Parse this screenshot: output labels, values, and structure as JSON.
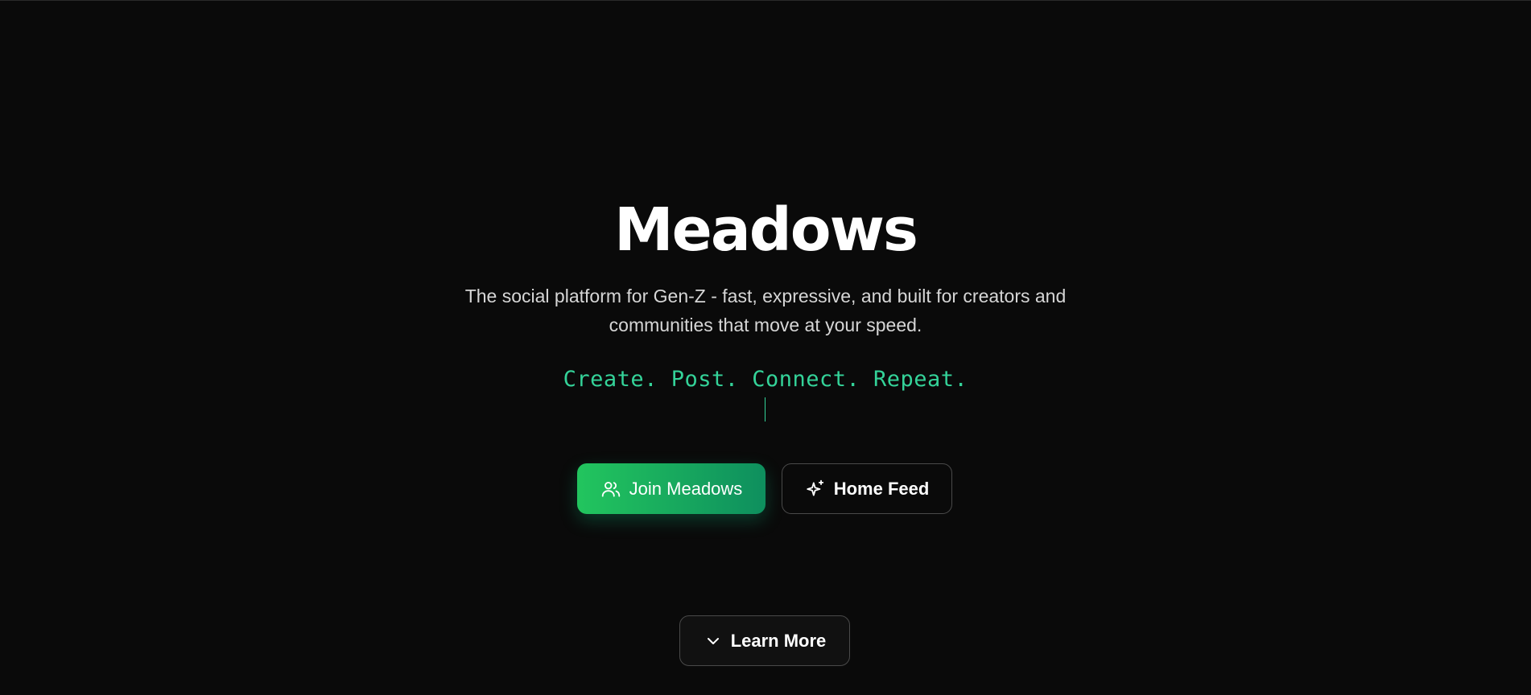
{
  "hero": {
    "title": "Meadows",
    "subtitle": "The social platform for Gen-Z - fast, expressive, and built for creators and communities that move at your speed.",
    "tagline": "Create. Post. Connect. Repeat."
  },
  "actions": {
    "join_label": "Join Meadows",
    "join_icon": "users-icon",
    "home_label": "Home Feed",
    "home_icon": "sparkles-icon",
    "learn_label": "Learn More",
    "learn_icon": "chevron-down-icon"
  },
  "colors": {
    "background": "#0a0a0a",
    "accent": "#34d399",
    "primary_gradient_start": "#22c55e",
    "primary_gradient_end": "#0e8f5e"
  }
}
